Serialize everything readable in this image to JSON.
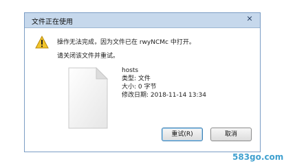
{
  "dialog": {
    "title": "文件正在使用",
    "close_glyph": "✕",
    "message": "操作无法完成，因为文件已在 rwyNCMc 中打开。",
    "instruction": "请关闭该文件并重试。"
  },
  "file": {
    "name": "hosts",
    "type": "类型: 文件",
    "size": "大小: 0 字节",
    "modified": "修改日期: 2018-11-14 13:34"
  },
  "buttons": {
    "retry": "重试(R)",
    "cancel": "取消"
  },
  "watermark": "583go.com",
  "icons": {
    "warning": "warning-icon",
    "file": "file-document-icon"
  },
  "colors": {
    "title_bar": "#c6d8ec",
    "watermark": "#3fa0cf"
  }
}
